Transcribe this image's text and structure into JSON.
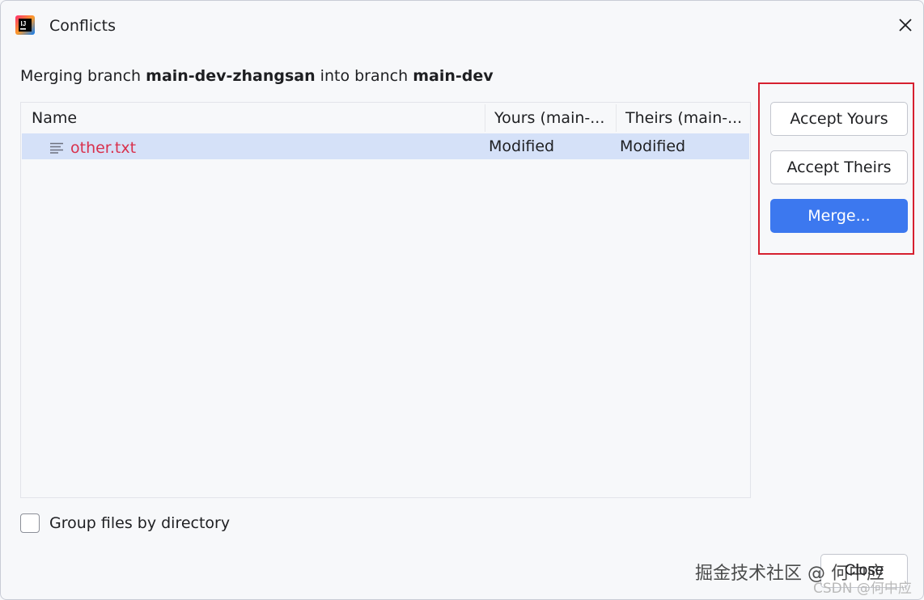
{
  "window": {
    "title": "Conflicts",
    "app_icon": "intellij-idea-icon",
    "close_icon": "close-icon"
  },
  "merge_info": {
    "prefix": "Merging branch ",
    "source_branch": "main-dev-zhangsan",
    "middle": " into branch ",
    "target_branch": "main-dev"
  },
  "table": {
    "columns": [
      "Name",
      "Yours (main-...",
      "Theirs (main-..."
    ],
    "rows": [
      {
        "file_icon": "text-file-icon",
        "name": "other.txt",
        "yours": "Modified",
        "theirs": "Modified"
      }
    ]
  },
  "actions": {
    "accept_yours": "Accept Yours",
    "accept_theirs": "Accept Theirs",
    "merge": "Merge..."
  },
  "options": {
    "group_by_directory_label": "Group files by directory",
    "group_by_directory_checked": false
  },
  "footer": {
    "close_label": "Close"
  },
  "watermark": {
    "primary": "掘金技术社区 @ 何中应",
    "secondary": "CSDN @何中应"
  },
  "colors": {
    "selection": "#d5e1f8",
    "conflict_file": "#d9304c",
    "primary_button": "#3c78ef",
    "highlight_frame": "#d6202f"
  }
}
